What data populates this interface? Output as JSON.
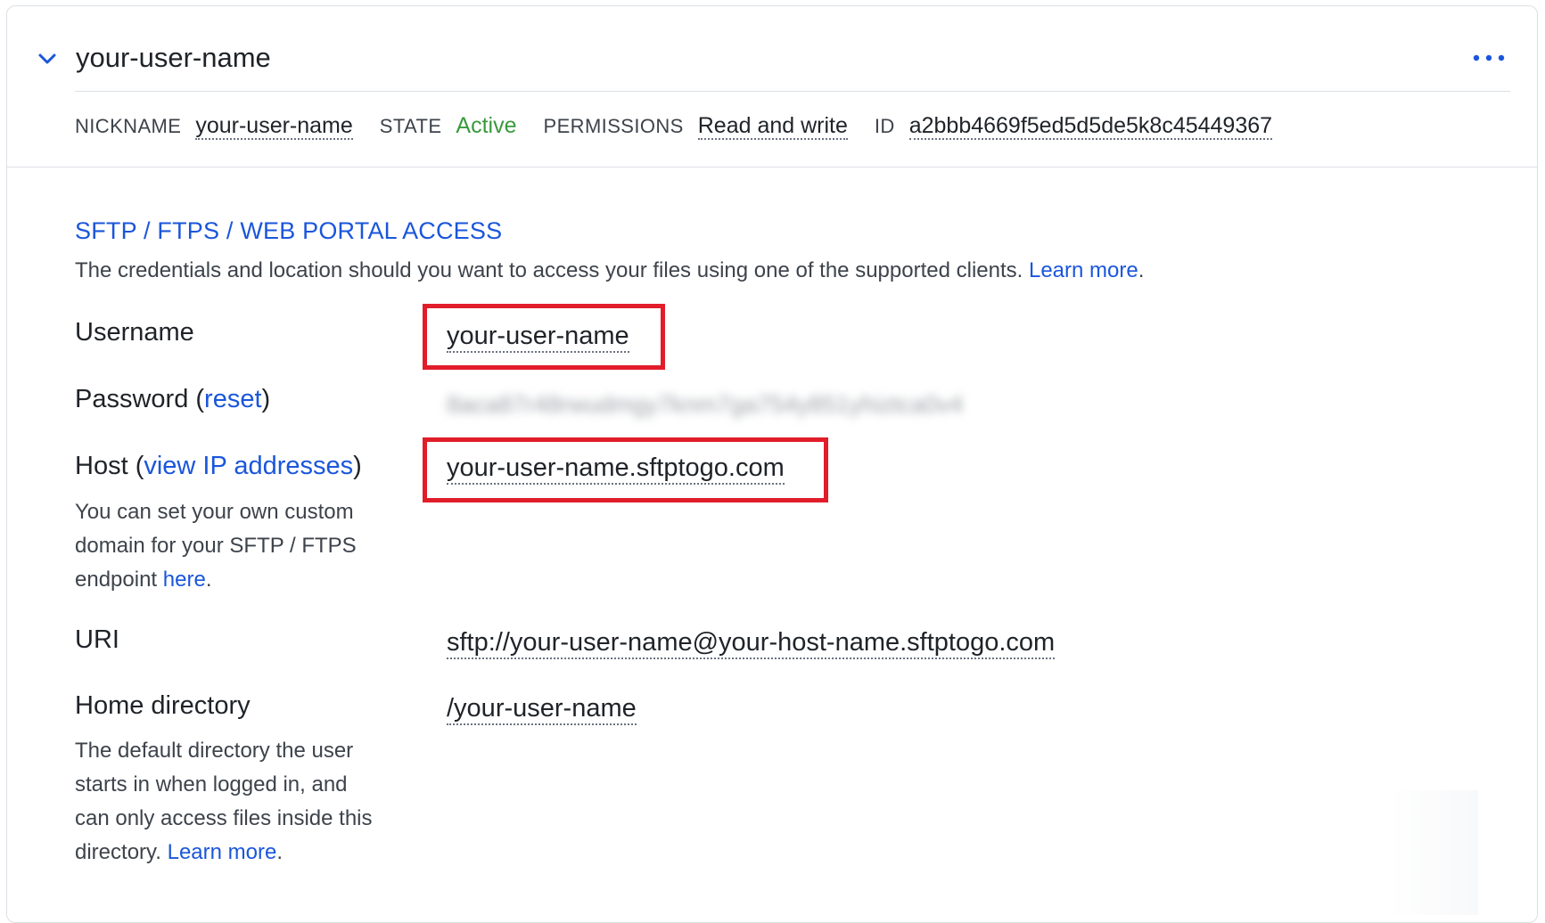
{
  "header": {
    "title": "your-user-name",
    "meta": {
      "nickname_label": "NICKNAME",
      "nickname_value": "your-user-name",
      "state_label": "STATE",
      "state_value": "Active",
      "permissions_label": "PERMISSIONS",
      "permissions_value": "Read and write",
      "id_label": "ID",
      "id_value": "a2bbb4669f5ed5d5de5k8c45449367"
    }
  },
  "access": {
    "title": "SFTP / FTPS / WEB PORTAL ACCESS",
    "description": "The credentials and location should you want to access your files using one of the supported clients.",
    "learn_more": "Learn more",
    "period": "."
  },
  "fields": {
    "username": {
      "label": "Username",
      "value": "your-user-name"
    },
    "password": {
      "label": "Password",
      "open_paren": " (",
      "reset_link": "reset",
      "close_paren": ")",
      "value_masked": "8aca87r48rwudmgy7knm7ga754y851yhiztca0v4"
    },
    "host": {
      "label": "Host",
      "open_paren": " (",
      "view_ip_link": "view IP addresses",
      "close_paren": ")",
      "help_text": "You can set your own custom domain for your SFTP / FTPS endpoint",
      "help_link": "here",
      "help_period": ".",
      "value": "your-user-name.sftptogo.com"
    },
    "uri": {
      "label": "URI",
      "value": "sftp://your-user-name@your-host-name.sftptogo.com"
    },
    "home": {
      "label": "Home directory",
      "help_text": "The default directory the user starts in when logged in, and can only access files inside this directory.",
      "help_link": "Learn more",
      "help_period": ".",
      "value": "/your-user-name"
    }
  },
  "colors": {
    "accent": "#1a56db",
    "active": "#3a9a3d",
    "highlight": "#e11d2a"
  },
  "icons": {
    "collapse": "chevron-down-icon",
    "menu": "more-horizontal-icon"
  }
}
